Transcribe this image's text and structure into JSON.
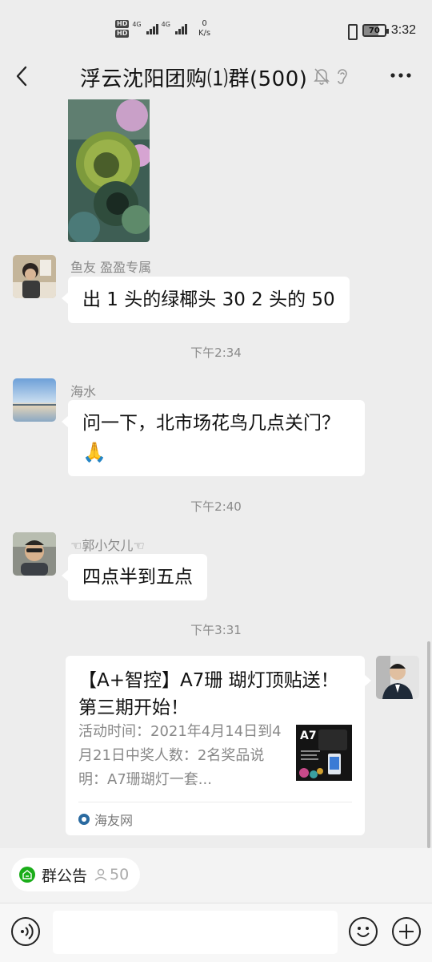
{
  "status": {
    "net_badges": [
      "HD",
      "HD"
    ],
    "signal_labels": [
      "4G",
      "4G"
    ],
    "speed_value": "0",
    "speed_unit": "K/s",
    "battery": "70",
    "time": "3:32"
  },
  "header": {
    "title": "浮云沈阳团购⑴群(500)"
  },
  "messages": [
    {
      "type": "image",
      "sender": ""
    },
    {
      "type": "text",
      "sender": "鱼友 盈盈专属",
      "text": "出 1 头的绿椰头 30   2 头的 50"
    },
    {
      "type": "time",
      "text": "下午2:34"
    },
    {
      "type": "text",
      "sender": "海水",
      "text": "问一下，北市场花鸟几点关门？",
      "emoji": "🙏"
    },
    {
      "type": "time",
      "text": "下午2:40"
    },
    {
      "type": "text",
      "sender": "☜郭小欠儿☜",
      "text": "四点半到五点"
    },
    {
      "type": "time",
      "text": "下午3:31"
    }
  ],
  "card": {
    "title": "【A+智控】A7珊 瑚灯顶贴送！第三期开始！",
    "desc": "活动时间：2021年4月14日到4月21日中奖人数：2名奖品说明：A7珊瑚灯一套...",
    "thumb_label": "A7",
    "source": "海友网"
  },
  "notice": {
    "label": "群公告",
    "count": "50"
  },
  "input": {
    "placeholder": ""
  }
}
